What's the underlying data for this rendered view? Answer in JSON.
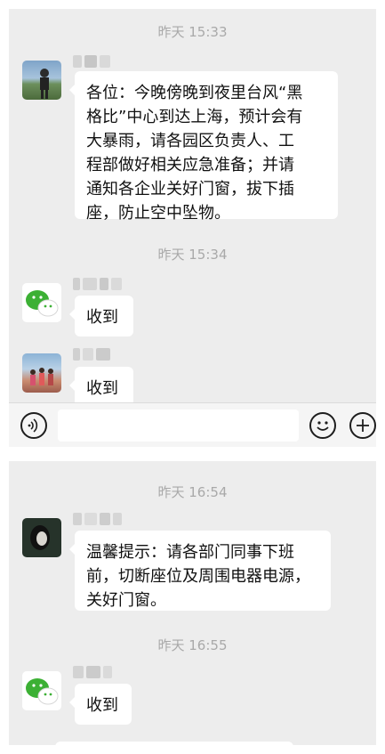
{
  "chat_top": {
    "timestamp_1": "昨天 15:33",
    "message_1": "各位：今晚傍晚到夜里台风“黑\n格比”中心到达上海，预计会有\n大暴雨，请各园区负责人、工\n程部做好相关应急准备；并请\n通知各企业关好门窗，拔下插\n座，防止空中坠物。",
    "timestamp_2": "昨天 15:34",
    "message_2": "收到",
    "message_3": "收到"
  },
  "input_bar": {
    "voice_icon": "voice-icon",
    "emoji_icon": "emoji-icon",
    "plus_icon": "plus-icon",
    "value": ""
  },
  "chat_bottom": {
    "timestamp_1": "昨天 16:54",
    "message_1": "温馨提示：请各部门同事下班\n前，切断座位及周围电器电源，\n关好门窗。",
    "timestamp_2": "昨天 16:55",
    "message_2": "收到"
  },
  "colors": {
    "background": "#ededed",
    "bubble": "#ffffff",
    "timestamp": "#a9a9a9",
    "wechat_green": "#3cb034"
  }
}
